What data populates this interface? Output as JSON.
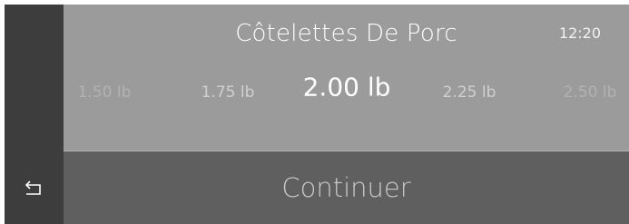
{
  "header": {
    "title": "Côtelettes De Porc",
    "time": "12:20"
  },
  "weight_picker": {
    "options": [
      "1.50 lb",
      "1.75 lb",
      "2.00 lb",
      "2.25 lb",
      "2.50 lb"
    ],
    "selected": "2.00 lb"
  },
  "footer": {
    "continue_label": "Continuer"
  },
  "icons": {
    "back": "back-arrow-icon"
  },
  "colors": {
    "panel": "#9b9b9b",
    "rail": "#3d3d3d",
    "footer": "#5f5f5f"
  }
}
